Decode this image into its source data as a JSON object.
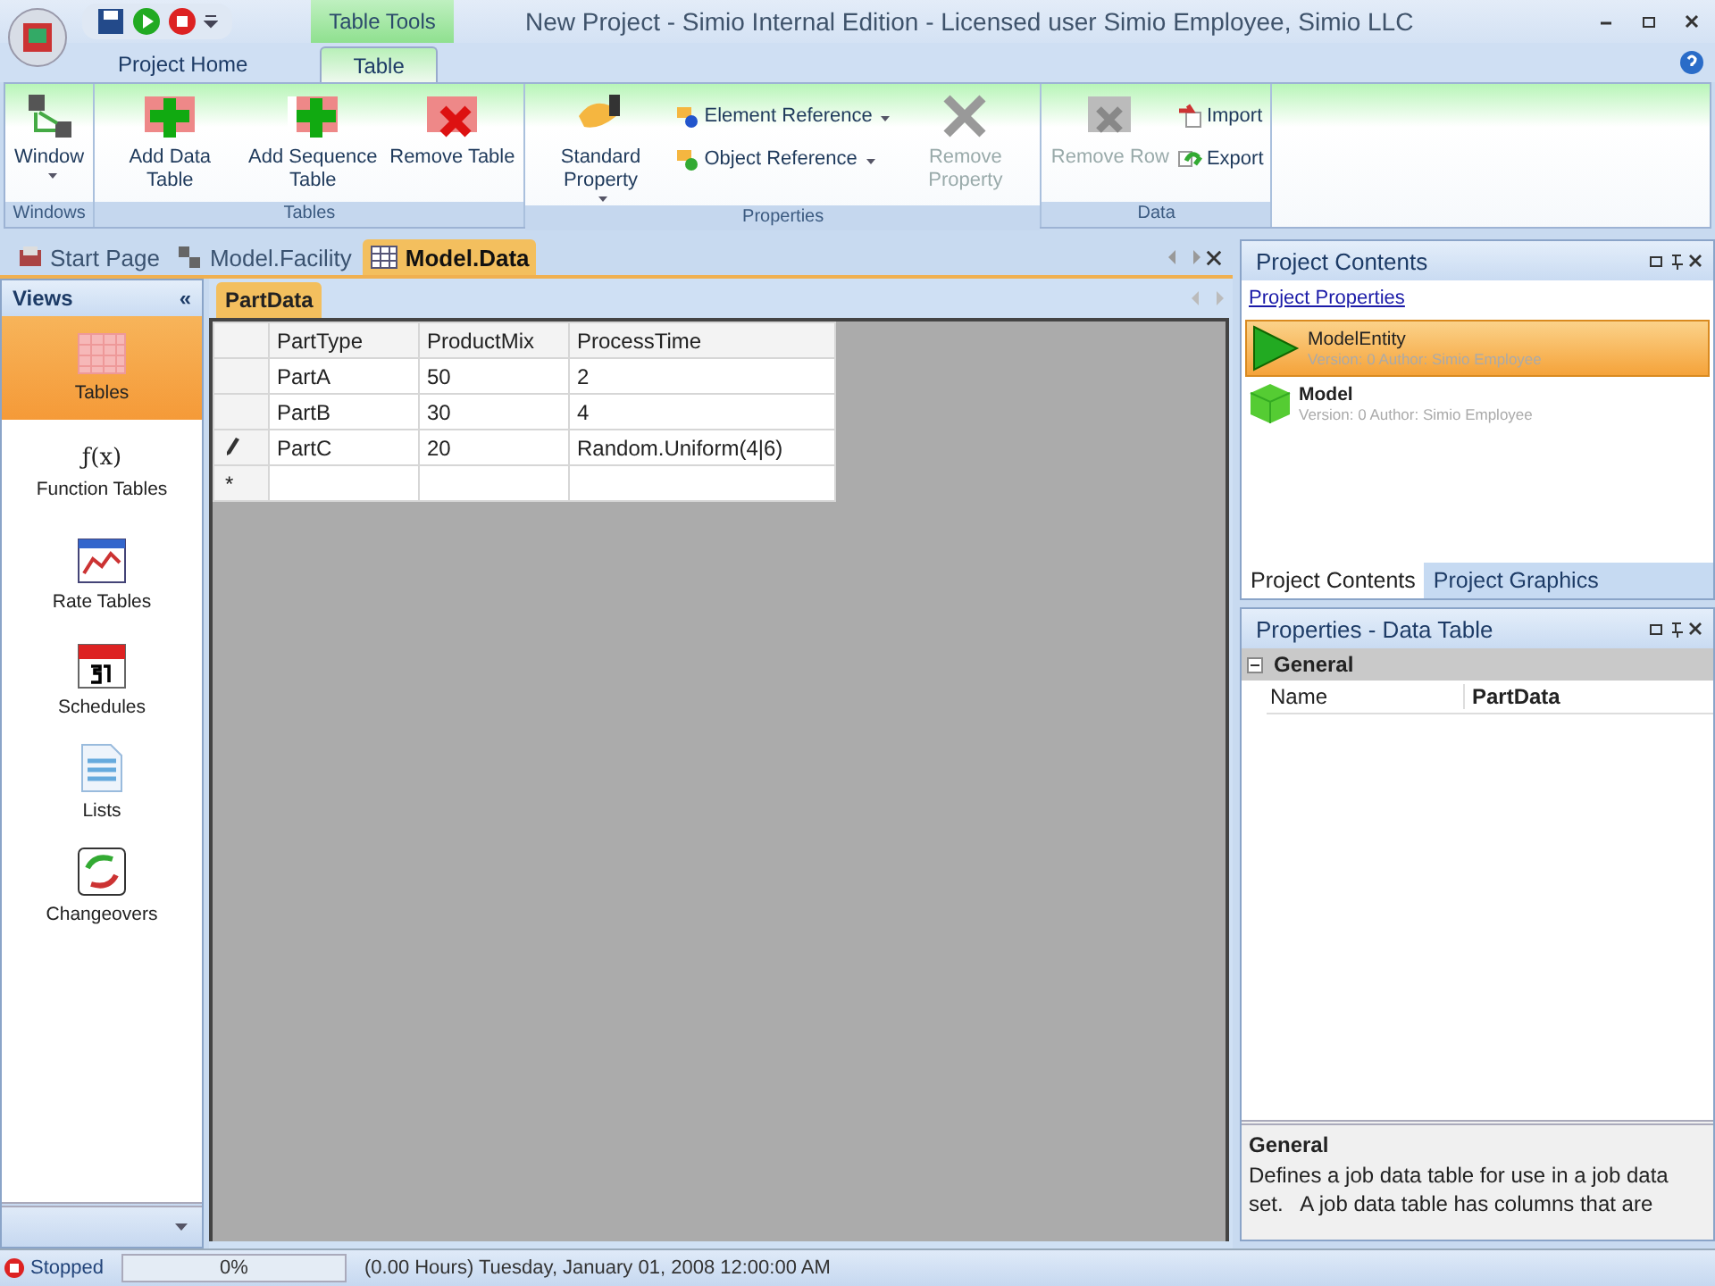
{
  "window": {
    "title": "New Project - Simio Internal Edition - Licensed user Simio Employee, Simio LLC",
    "context_group": "Table Tools"
  },
  "ribbon_tabs": [
    {
      "label": "Project Home",
      "selected": false
    },
    {
      "label": "Table",
      "selected": true
    }
  ],
  "ribbon_groups": [
    {
      "label": "Windows",
      "items": [
        {
          "label": "Window",
          "kind": "large",
          "dropdown": true,
          "disabled": false
        }
      ]
    },
    {
      "label": "Tables",
      "items": [
        {
          "label": "Add Data Table",
          "kind": "large",
          "dropdown": false,
          "disabled": false
        },
        {
          "label": "Add Sequence Table",
          "kind": "large",
          "dropdown": false,
          "disabled": false
        },
        {
          "label": "Remove Table",
          "kind": "large",
          "dropdown": false,
          "disabled": false
        }
      ]
    },
    {
      "label": "Properties",
      "items": [
        {
          "label": "Standard Property",
          "kind": "large",
          "dropdown": true,
          "disabled": false
        },
        {
          "label": "Element Reference",
          "kind": "small",
          "dropdown": true,
          "disabled": false
        },
        {
          "label": "Object Reference",
          "kind": "small",
          "dropdown": true,
          "disabled": false
        },
        {
          "label": "Remove Property",
          "kind": "large",
          "dropdown": false,
          "disabled": true
        }
      ]
    },
    {
      "label": "Data",
      "items": [
        {
          "label": "Remove Row",
          "kind": "large",
          "dropdown": false,
          "disabled": true
        },
        {
          "label": "Import",
          "kind": "small",
          "dropdown": false,
          "disabled": false
        },
        {
          "label": "Export",
          "kind": "small",
          "dropdown": false,
          "disabled": false
        }
      ]
    }
  ],
  "document_tabs": [
    {
      "label": "Start Page",
      "selected": false
    },
    {
      "label": "Model.Facility",
      "selected": false
    },
    {
      "label": "Model.Data",
      "selected": true
    }
  ],
  "views": {
    "title": "Views",
    "collapse": "«",
    "items": [
      {
        "label": "Tables",
        "selected": true
      },
      {
        "label": "Function Tables",
        "selected": false,
        "symbol": "ƒ(x)"
      },
      {
        "label": "Rate Tables",
        "selected": false
      },
      {
        "label": "Schedules",
        "selected": false
      },
      {
        "label": "Lists",
        "selected": false
      },
      {
        "label": "Changeovers",
        "selected": false
      }
    ]
  },
  "table": {
    "tabs": [
      {
        "label": "PartData",
        "selected": true
      }
    ],
    "columns": [
      "PartType",
      "ProductMix",
      "ProcessTime"
    ],
    "rows": [
      {
        "kind": "data",
        "cells": [
          "PartA",
          "50",
          "2"
        ]
      },
      {
        "kind": "data",
        "cells": [
          "PartB",
          "30",
          "4"
        ]
      },
      {
        "kind": "editing",
        "cells": [
          "PartC",
          "20",
          "Random.Uniform(4|6)"
        ]
      },
      {
        "kind": "new",
        "marker": "*",
        "cells": []
      }
    ]
  },
  "project_contents": {
    "title": "Project Contents",
    "link": "Project Properties",
    "items": [
      {
        "name": "ModelEntity",
        "meta": "Version: 0 Author: Simio Employee",
        "selected": true
      },
      {
        "name": "Model",
        "meta": "Version: 0 Author: Simio Employee",
        "selected": false
      }
    ],
    "tabs": [
      {
        "label": "Project Contents",
        "selected": true
      },
      {
        "label": "Project Graphics",
        "selected": false
      }
    ]
  },
  "properties": {
    "title": "Properties - Data Table",
    "category": "General",
    "rows": [
      {
        "name": "Name",
        "value": "PartData"
      }
    ],
    "description_title": "General",
    "description": "Defines a job data table for use in a job data set.   A job data table has columns that are"
  },
  "status_bar": {
    "state": "Stopped",
    "progress": {
      "level": 0,
      "reading": "0%"
    },
    "time": "(0.00 Hours) Tuesday, January 01, 2008 12:00:00 AM"
  }
}
